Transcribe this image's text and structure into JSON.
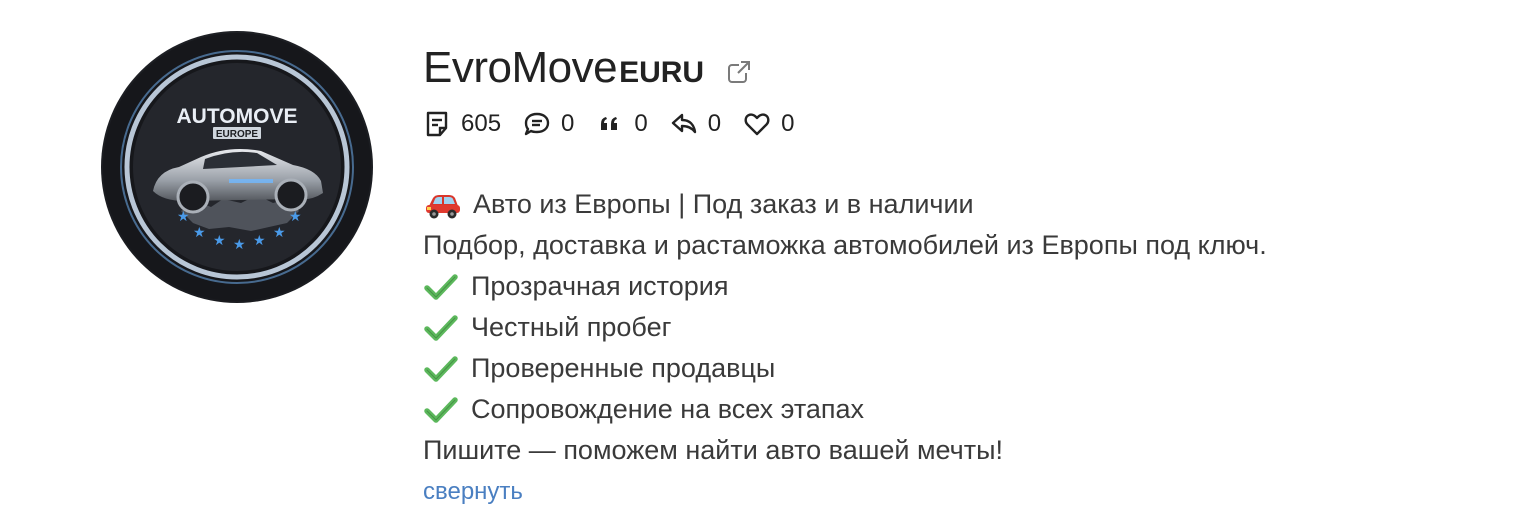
{
  "profile": {
    "name": "EvroMove",
    "name_suffix": "EURU",
    "avatar_text": {
      "brand": "AUTOMOVE",
      "sub": "EUROPE"
    },
    "external_link_icon": "external-link-icon"
  },
  "stats": [
    {
      "icon": "posts-icon",
      "value": "605"
    },
    {
      "icon": "comments-icon",
      "value": "0"
    },
    {
      "icon": "quote-icon",
      "value": "0"
    },
    {
      "icon": "reply-icon",
      "value": "0"
    },
    {
      "icon": "heart-icon",
      "value": "0"
    }
  ],
  "description": {
    "line1_icon": "car-icon",
    "line1": "Авто из Европы | Под заказ и в наличии",
    "line2": "Подбор, доставка и растаможка автомобилей из Европы под ключ.",
    "checks": [
      "Прозрачная история",
      "Честный пробег",
      "Проверенные продавцы",
      "Сопровождение на всех этапах"
    ],
    "line_final": "Пишите — поможем найти авто вашей мечты!"
  },
  "collapse_label": "свернуть",
  "colors": {
    "link": "#4a7fc1",
    "check": "#5cb85c",
    "text": "#333333"
  }
}
